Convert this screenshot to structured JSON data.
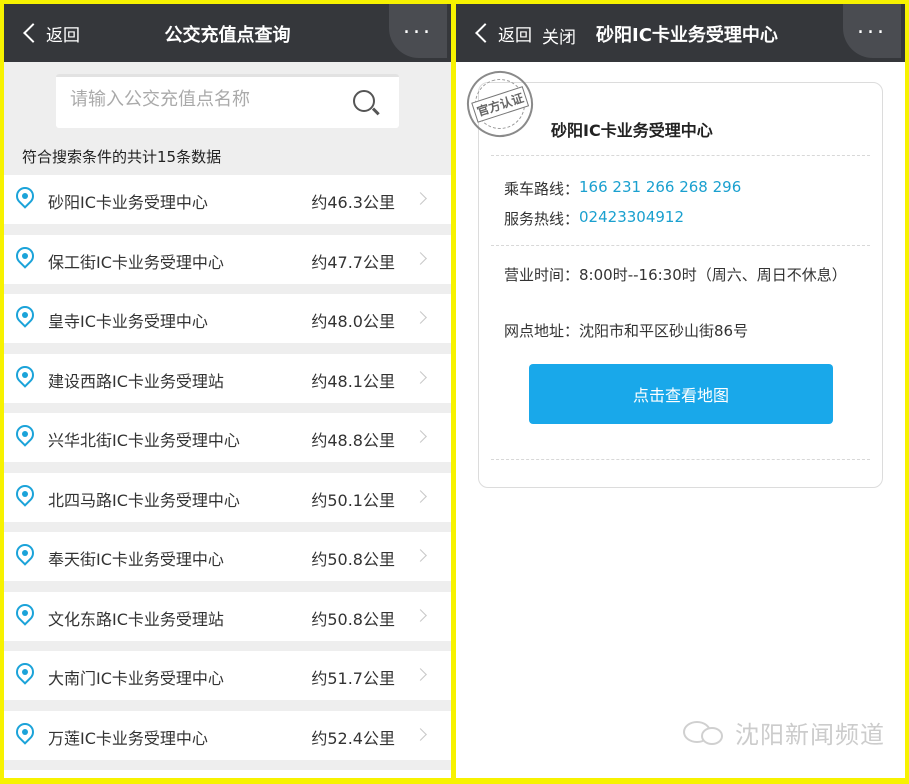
{
  "left": {
    "nav": {
      "back_label": "返回",
      "title": "公交充值点查询",
      "more_label": "..."
    },
    "search": {
      "placeholder": "请输入公交充值点名称"
    },
    "result_count": "符合搜索条件的共计15条数据",
    "items": [
      {
        "name": "砂阳IC卡业务受理中心",
        "distance": "约46.3公里"
      },
      {
        "name": "保工街IC卡业务受理中心",
        "distance": "约47.7公里"
      },
      {
        "name": "皇寺IC卡业务受理中心",
        "distance": "约48.0公里"
      },
      {
        "name": "建设西路IC卡业务受理站",
        "distance": "约48.1公里"
      },
      {
        "name": "兴华北街IC卡业务受理中心",
        "distance": "约48.8公里"
      },
      {
        "name": "北四马路IC卡业务受理中心",
        "distance": "约50.1公里"
      },
      {
        "name": "奉天街IC卡业务受理中心",
        "distance": "约50.8公里"
      },
      {
        "name": "文化东路IC卡业务受理站",
        "distance": "约50.8公里"
      },
      {
        "name": "大南门IC卡业务受理中心",
        "distance": "约51.7公里"
      },
      {
        "name": "万莲IC卡业务受理中心",
        "distance": "约52.4公里"
      },
      {
        "name": "",
        "distance": ""
      }
    ]
  },
  "right": {
    "nav": {
      "back_label": "返回",
      "close_label": "关闭",
      "title": "砂阳IC卡业务受理中心",
      "more_label": "..."
    },
    "stamp_text": "官方认证",
    "card_title": "砂阳IC卡业务受理中心",
    "bus_routes_label": "乘车路线：",
    "bus_routes_value": "166 231 266 268 296",
    "hotline_label": "服务热线：",
    "hotline_value": "02423304912",
    "hours_label": "营业时间：",
    "hours_value": "8:00时--16:30时（周六、周日不休息）",
    "address_label": "网点地址：",
    "address_value": "沈阳市和平区砂山街86号",
    "map_button_label": "点击查看地图"
  },
  "watermark": {
    "text": "沈阳新闻频道"
  },
  "colors": {
    "frame": "#f7f200",
    "navbar": "#35373b",
    "accent": "#19a8ea",
    "link": "#1aa0cf"
  }
}
